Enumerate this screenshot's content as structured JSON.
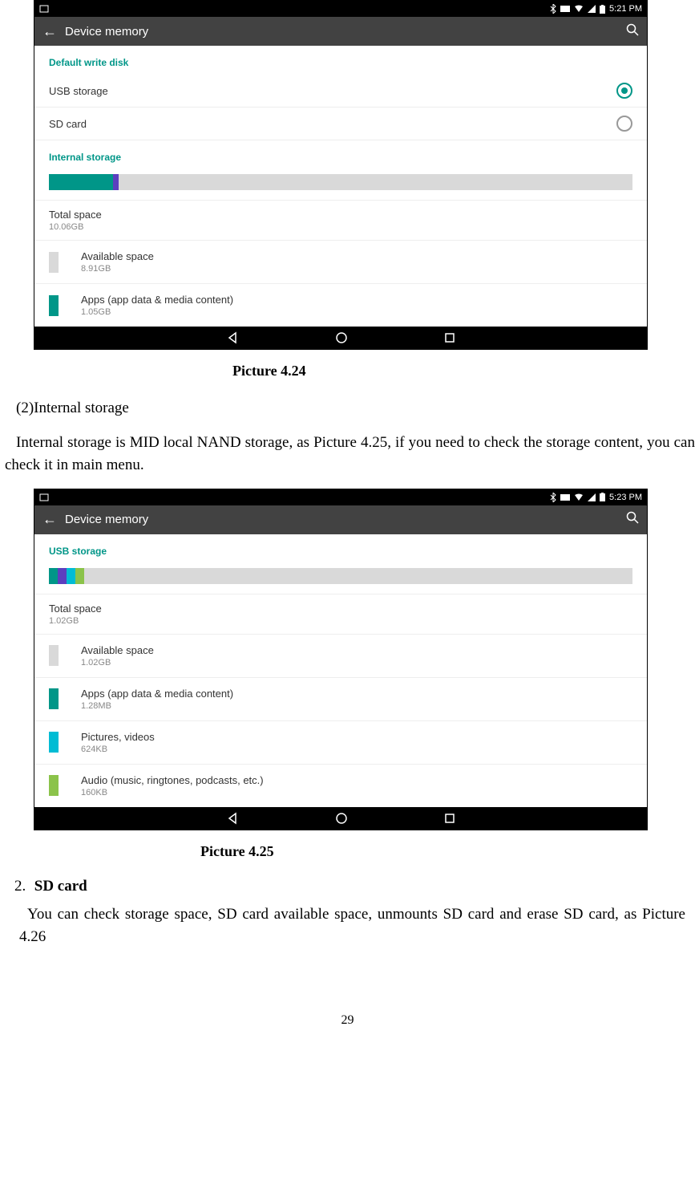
{
  "shot_a": {
    "status_time": "5:21 PM",
    "appbar_title": "Device memory",
    "section_default": "Default write disk",
    "opt_usb": "USB storage",
    "opt_sd": "SD card",
    "section_internal": "Internal storage",
    "total_label": "Total space",
    "total_value": "10.06GB",
    "items": [
      {
        "title": "Available space",
        "value": "8.91GB",
        "color": "#d9d9d9"
      },
      {
        "title": "Apps (app data & media content)",
        "value": "1.05GB",
        "color": "#009688"
      }
    ],
    "bar_segments": [
      {
        "color": "#009688",
        "pct": 11
      },
      {
        "color": "#5c3fbf",
        "pct": 1
      },
      {
        "color": "#d9d9d9",
        "pct": 88
      }
    ]
  },
  "caption_a": "Picture 4.24",
  "para_a1": "(2)Internal storage",
  "para_a2": "Internal storage is MID local NAND storage, as Picture 4.25, if you need to check the storage content, you can check it in main menu.",
  "shot_b": {
    "status_time": "5:23 PM",
    "appbar_title": "Device memory",
    "section_usb": "USB storage",
    "total_label": "Total space",
    "total_value": "1.02GB",
    "items": [
      {
        "title": "Available space",
        "value": "1.02GB",
        "color": "#d9d9d9"
      },
      {
        "title": "Apps (app data & media content)",
        "value": "1.28MB",
        "color": "#009688"
      },
      {
        "title": "Pictures, videos",
        "value": "624KB",
        "color": "#00bcd4"
      },
      {
        "title": "Audio (music, ringtones, podcasts, etc.)",
        "value": "160KB",
        "color": "#8bc34a"
      }
    ],
    "bar_segments": [
      {
        "color": "#009688",
        "pct": 1.5
      },
      {
        "color": "#5c3fbf",
        "pct": 1.5
      },
      {
        "color": "#00bcd4",
        "pct": 1.5
      },
      {
        "color": "#8bc34a",
        "pct": 1.5
      },
      {
        "color": "#d9d9d9",
        "pct": 94
      }
    ]
  },
  "caption_b": "Picture 4.25",
  "heading_num": "2.",
  "heading_txt": "SD card",
  "para_b": "You can check storage space, SD card available space, unmounts SD card and erase SD card, as Picture 4.26",
  "page_number": "29"
}
